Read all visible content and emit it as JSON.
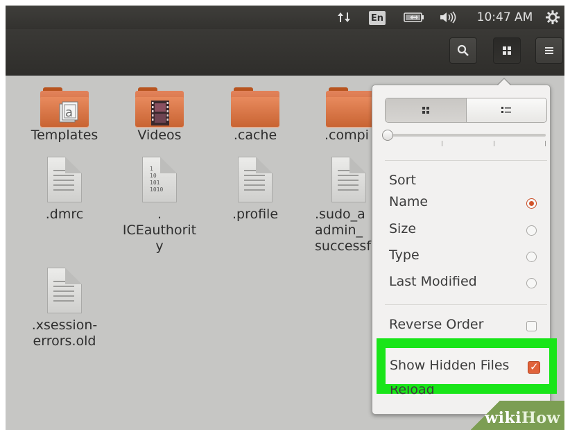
{
  "topbar": {
    "keyboard_lang": "En",
    "clock": "10:47 AM"
  },
  "files": [
    {
      "name": "Templates",
      "kind": "folder-templates"
    },
    {
      "name": "Videos",
      "kind": "folder-videos"
    },
    {
      "name": ".cache",
      "kind": "folder"
    },
    {
      "name": ".compi",
      "kind": "folder"
    },
    {
      "name": ".dmrc",
      "kind": "document"
    },
    {
      "name": ".\nICEauthorit\ny",
      "kind": "binary"
    },
    {
      "name": ".profile",
      "kind": "document"
    },
    {
      "name": ".sudo_a\nadmin_\nsuccessf",
      "kind": "document"
    },
    {
      "name": ".xsession-\nerrors.old",
      "kind": "document"
    }
  ],
  "binary_icon_text": "1\n10\n101\n1010",
  "popover": {
    "sort_heading": "Sort",
    "sort_options": [
      {
        "label": "Name",
        "selected": true
      },
      {
        "label": "Size",
        "selected": false
      },
      {
        "label": "Type",
        "selected": false
      },
      {
        "label": "Last Modified",
        "selected": false
      }
    ],
    "reverse_order": {
      "label": "Reverse Order",
      "checked": false
    },
    "show_hidden": {
      "label": "Show Hidden Files",
      "checked": true
    },
    "reload_label": "Reload",
    "zoom_level": 0
  },
  "watermark": {
    "wiki": "wiki",
    "how": "How"
  },
  "colors": {
    "accent": "#d1532a",
    "highlight": "#19e519",
    "folder": "#d26a39",
    "watermark": "#7c9e53"
  }
}
